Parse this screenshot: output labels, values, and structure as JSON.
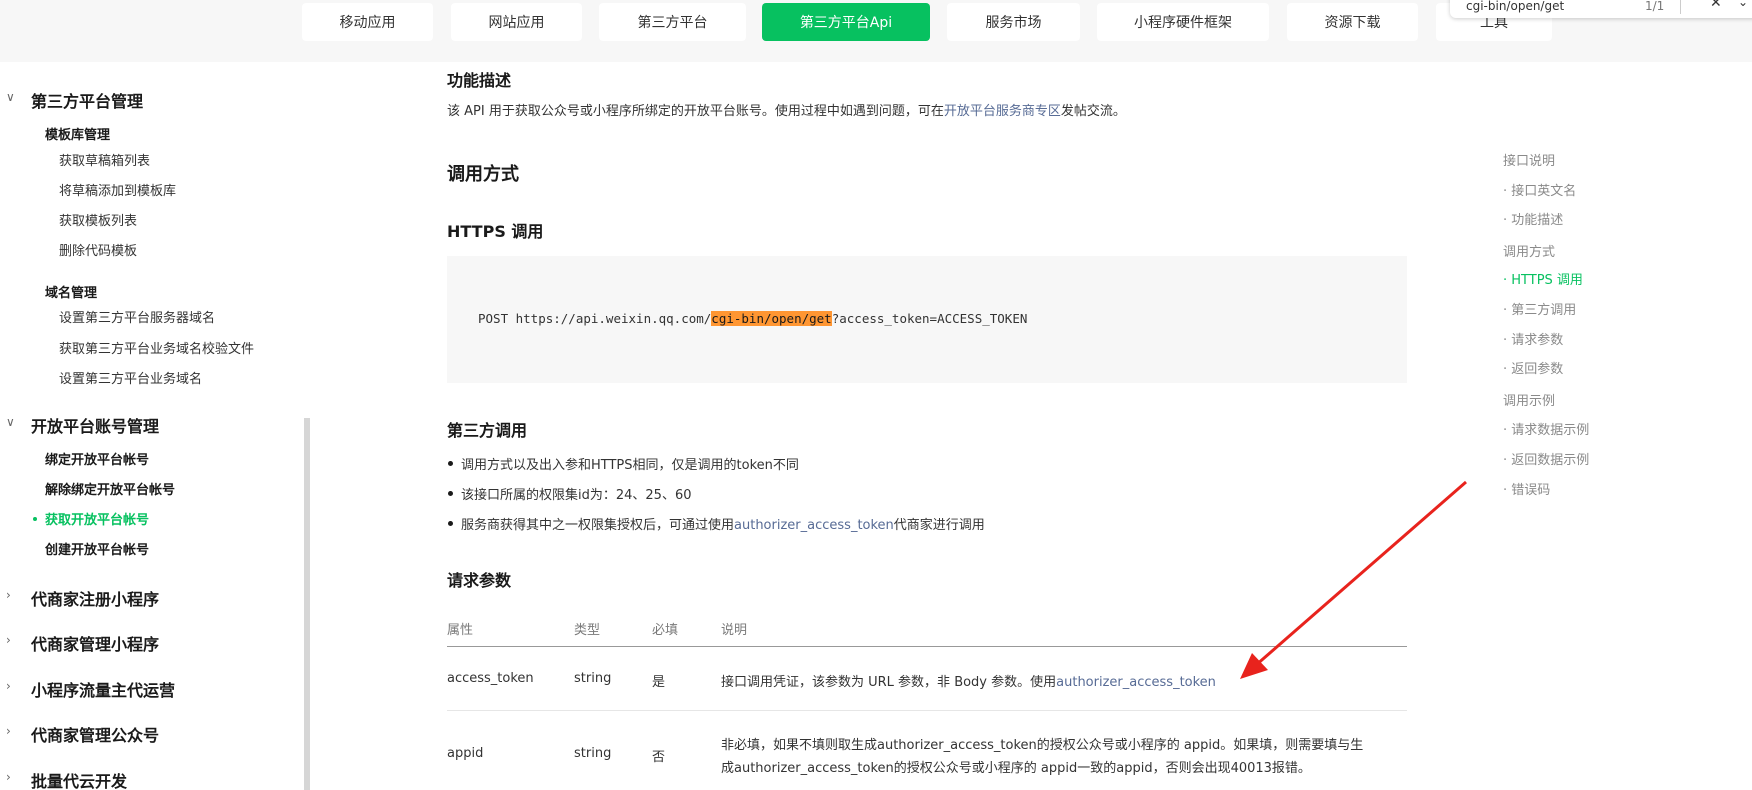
{
  "top_nav": [
    {
      "label": "移动应用",
      "active": false
    },
    {
      "label": "网站应用",
      "active": false
    },
    {
      "label": "第三方平台",
      "active": false
    },
    {
      "label": "第三方平台Api",
      "active": true
    },
    {
      "label": "服务市场",
      "active": false
    },
    {
      "label": "小程序硬件框架",
      "active": false
    },
    {
      "label": "资源下载",
      "active": false
    },
    {
      "label": "工具",
      "active": false
    }
  ],
  "find_bar": {
    "query": "cgi-bin/open/get",
    "count": "1/1"
  },
  "sidebar": {
    "section1": "第三方平台管理",
    "group1": "模板库管理",
    "group1_items": [
      "获取草稿箱列表",
      "将草稿添加到模板库",
      "获取模板列表",
      "删除代码模板"
    ],
    "group2": "域名管理",
    "group2_items": [
      "设置第三方平台服务器域名",
      "获取第三方平台业务域名校验文件",
      "设置第三方平台业务域名"
    ],
    "section2": "开放平台账号管理",
    "section2_items": [
      "绑定开放平台帐号",
      "解除绑定开放平台帐号",
      "获取开放平台帐号",
      "创建开放平台帐号"
    ],
    "collapsed": [
      "代商家注册小程序",
      "代商家管理小程序",
      "小程序流量主代运营",
      "代商家管理公众号",
      "批量代云开发"
    ]
  },
  "main": {
    "func_title": "功能描述",
    "func_desc_pre": "该 API 用于获取公众号或小程序所绑定的开放平台账号。使用过程中如遇到问题，可在",
    "func_desc_link": "开放平台服务商专区",
    "func_desc_post": "发帖交流。",
    "call_title": "调用方式",
    "https_title": "HTTPS 调用",
    "code_pre": "POST https://api.weixin.qq.com/",
    "code_hl": "cgi-bin/open/get",
    "code_post": "?access_token=ACCESS_TOKEN",
    "third_title": "第三方调用",
    "third_bullets": [
      "调用方式以及出入参和HTTPS相同，仅是调用的token不同",
      "该接口所属的权限集id为：24、25、60"
    ],
    "third_b3_pre": "服务商获得其中之一权限集授权后，可通过使用",
    "third_b3_link": "authorizer_access_token",
    "third_b3_post": "代商家进行调用",
    "req_title": "请求参数",
    "table_headers": [
      "属性",
      "类型",
      "必填",
      "说明"
    ],
    "rows": [
      {
        "name": "access_token",
        "type": "string",
        "required": "是",
        "desc_pre": "接口调用凭证，该参数为 URL 参数，非 Body 参数。使用",
        "desc_link": "authorizer_access_token"
      },
      {
        "name": "appid",
        "type": "string",
        "required": "否",
        "desc_line1": "非必填，如果不填则取生成authorizer_access_token的授权公众号或小程序的 appid。如果填，则需要填与生",
        "desc_line2": "成authorizer_access_token的授权公众号或小程序的 appid一致的appid，否则会出现40013报错。"
      }
    ]
  },
  "toc": [
    {
      "label": "接口说明",
      "sub": false,
      "active": false
    },
    {
      "label": "接口英文名",
      "sub": true,
      "active": false
    },
    {
      "label": "功能描述",
      "sub": true,
      "active": false
    },
    {
      "label": "调用方式",
      "sub": false,
      "active": false
    },
    {
      "label": "HTTPS 调用",
      "sub": true,
      "active": true
    },
    {
      "label": "第三方调用",
      "sub": true,
      "active": false
    },
    {
      "label": "请求参数",
      "sub": true,
      "active": false
    },
    {
      "label": "返回参数",
      "sub": true,
      "active": false
    },
    {
      "label": "调用示例",
      "sub": false,
      "active": false
    },
    {
      "label": "请求数据示例",
      "sub": true,
      "active": false
    },
    {
      "label": "返回数据示例",
      "sub": true,
      "active": false
    },
    {
      "label": "错误码",
      "sub": true,
      "active": false
    }
  ],
  "colors": {
    "accent": "#07c160",
    "link": "#576b95",
    "highlight": "#ff9632",
    "arrow": "#e8231d"
  }
}
